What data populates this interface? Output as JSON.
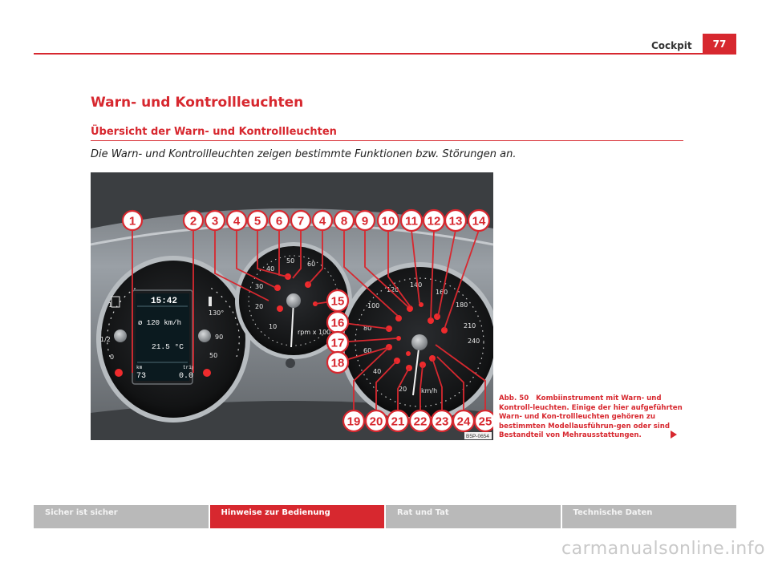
{
  "header": {
    "title": "Cockpit",
    "page_number": "77"
  },
  "section_title": "Warn- und Kontrollleuchten",
  "subsection_title": "Übersicht der Warn- und Kontrollleuchten",
  "intro_text": "Die Warn- und Kontrollleuchten zeigen bestimmte Funktionen bzw. Störungen an.",
  "figure": {
    "image_code": "B5P-0654",
    "callout_top_labels": [
      "1",
      "2",
      "3",
      "4",
      "5",
      "6",
      "7",
      "4",
      "8",
      "9",
      "10",
      "11",
      "12",
      "13",
      "14"
    ],
    "callout_side_labels": [
      "15",
      "16",
      "17",
      "18"
    ],
    "callout_bottom_labels": [
      "19",
      "20",
      "21",
      "22",
      "23",
      "24",
      "25"
    ],
    "display": {
      "time": "15:42",
      "speed": "ø 120 km/h",
      "temperature": "21.5 °C",
      "km_label": "km",
      "km_value": "73",
      "trip_label": "trip",
      "trip_value": "0.0"
    },
    "tacho": {
      "ticks": [
        "10",
        "20",
        "30",
        "40",
        "50",
        "60"
      ],
      "unit": "rpm x 100"
    },
    "speedo": {
      "ticks": [
        "20",
        "40",
        "60",
        "80",
        "100",
        "120",
        "140",
        "160",
        "180",
        "210",
        "240"
      ],
      "unit": "km/h"
    },
    "fuel_ticks": [
      "1",
      "1/2",
      "0"
    ],
    "temp_ticks": [
      "130°",
      "90",
      "50"
    ]
  },
  "caption": {
    "label": "Abb. 50",
    "text": "Kombiinstrument mit Warn- und Kontroll-leuchten. Einige der hier aufgeführten Warn- und Kon-trollleuchten gehören zu bestimmten Modellausführun-gen oder sind Bestandteil von Mehrausstattungen."
  },
  "footer_tabs": [
    "Sicher ist sicher",
    "Hinweise zur Bedienung",
    "Rat und Tat",
    "Technische Daten"
  ],
  "watermark": "carmanualsonline.info",
  "colors": {
    "accent": "#d7282f",
    "footer_gray": "#b9b9b9"
  }
}
